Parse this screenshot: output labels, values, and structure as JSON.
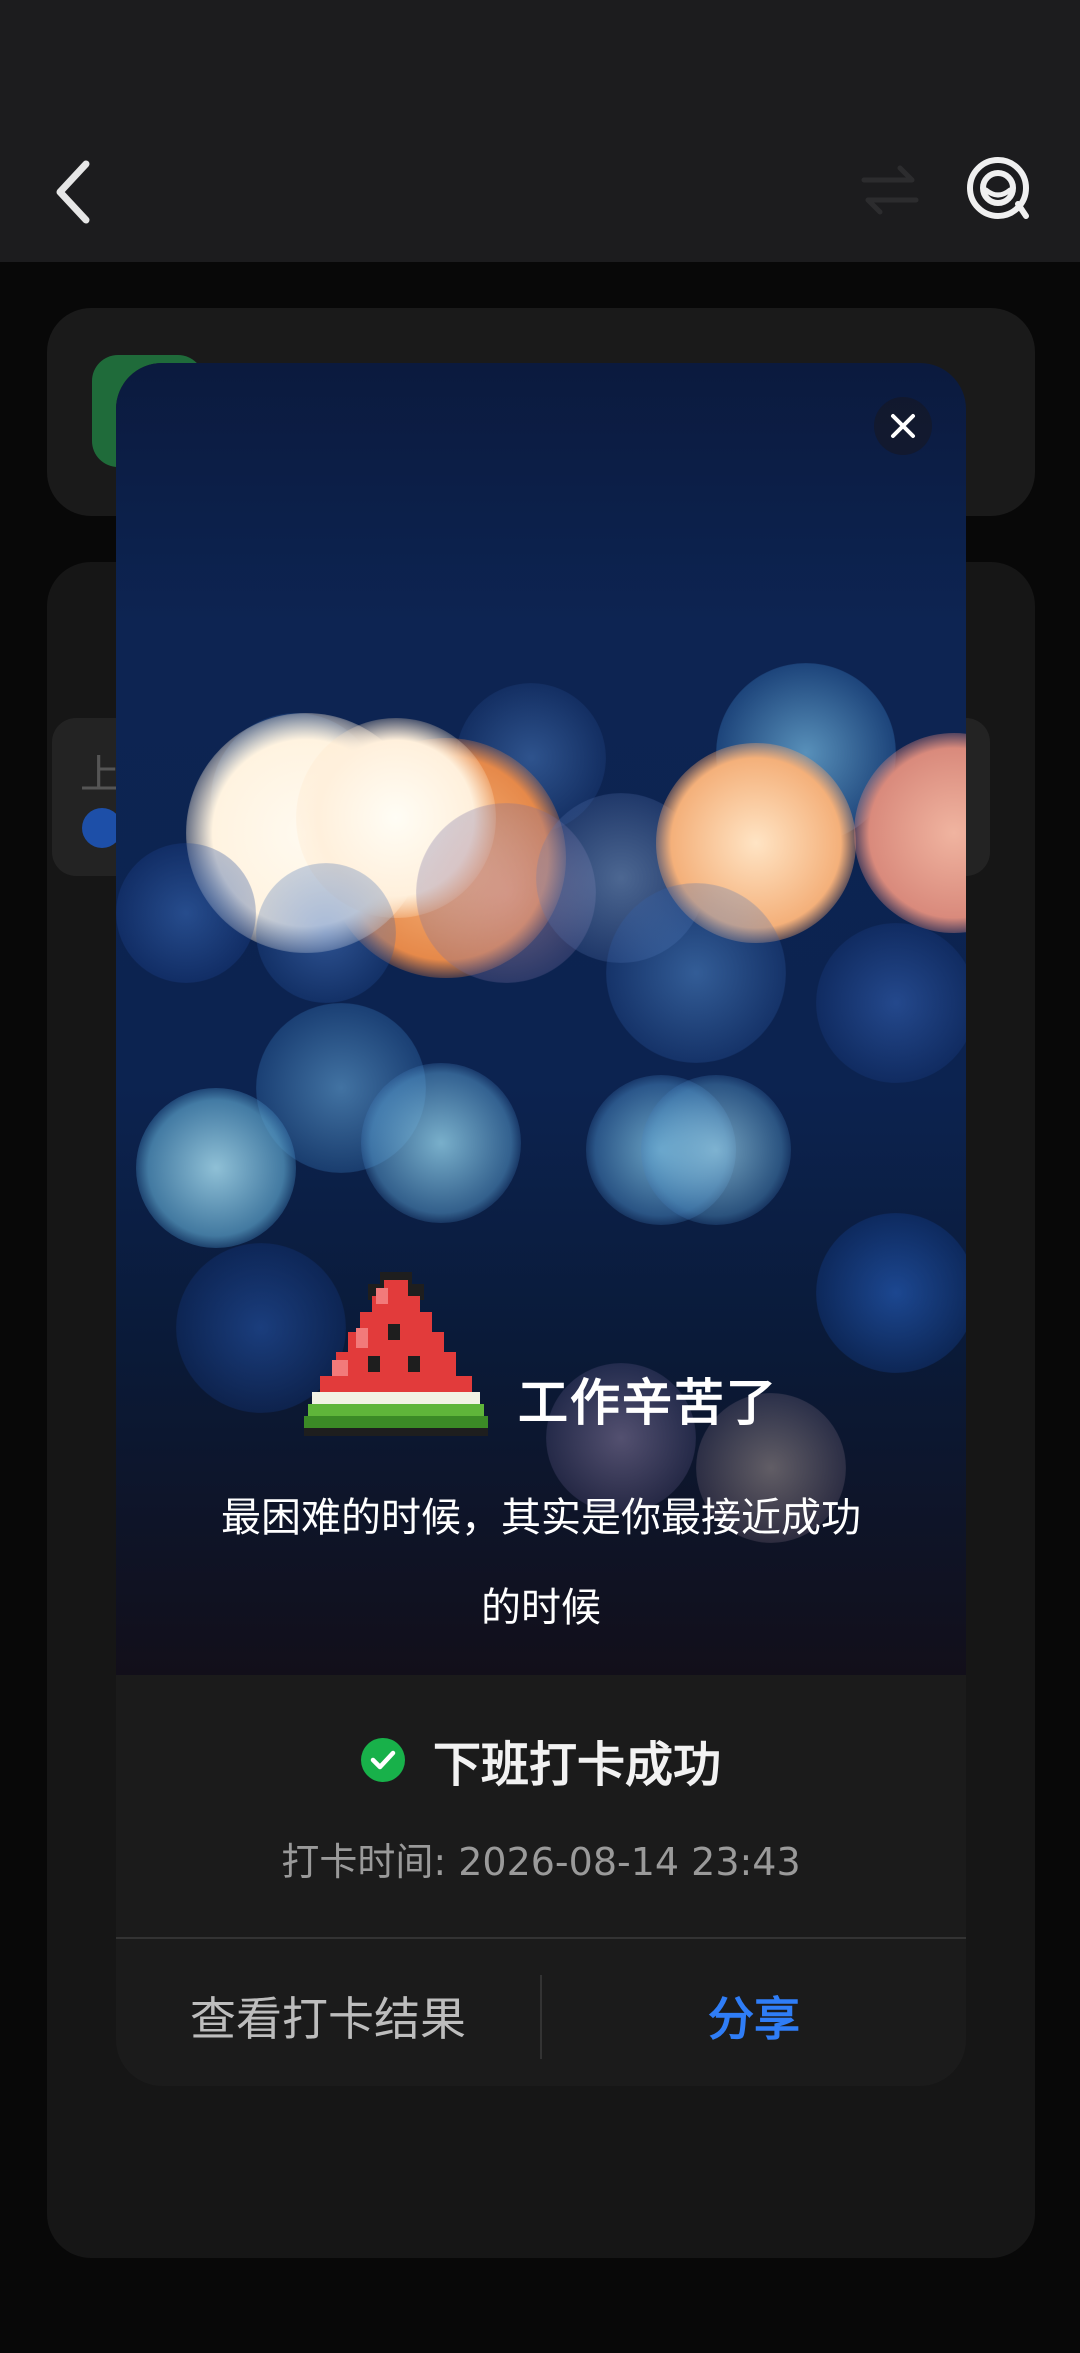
{
  "header": {
    "title": "",
    "back_icon": "back-arrow-icon",
    "switch_icon": "switch-icon",
    "assistant_icon": "assistant-icon"
  },
  "background": {
    "row_label": "上"
  },
  "modal": {
    "close_icon": "close-icon",
    "illustration": "watermelon-icon",
    "headline": "工作辛苦了",
    "subline": "最困难的时候，其实是你最接近成功的时候",
    "status_icon": "check-circle-icon",
    "status": "下班打卡成功",
    "time": "打卡时间: 2026-08-14 23:43",
    "buttons": {
      "view_result": "查看打卡结果",
      "share": "分享"
    },
    "colors": {
      "accent": "#2f7df6",
      "success": "#18b14a"
    }
  }
}
